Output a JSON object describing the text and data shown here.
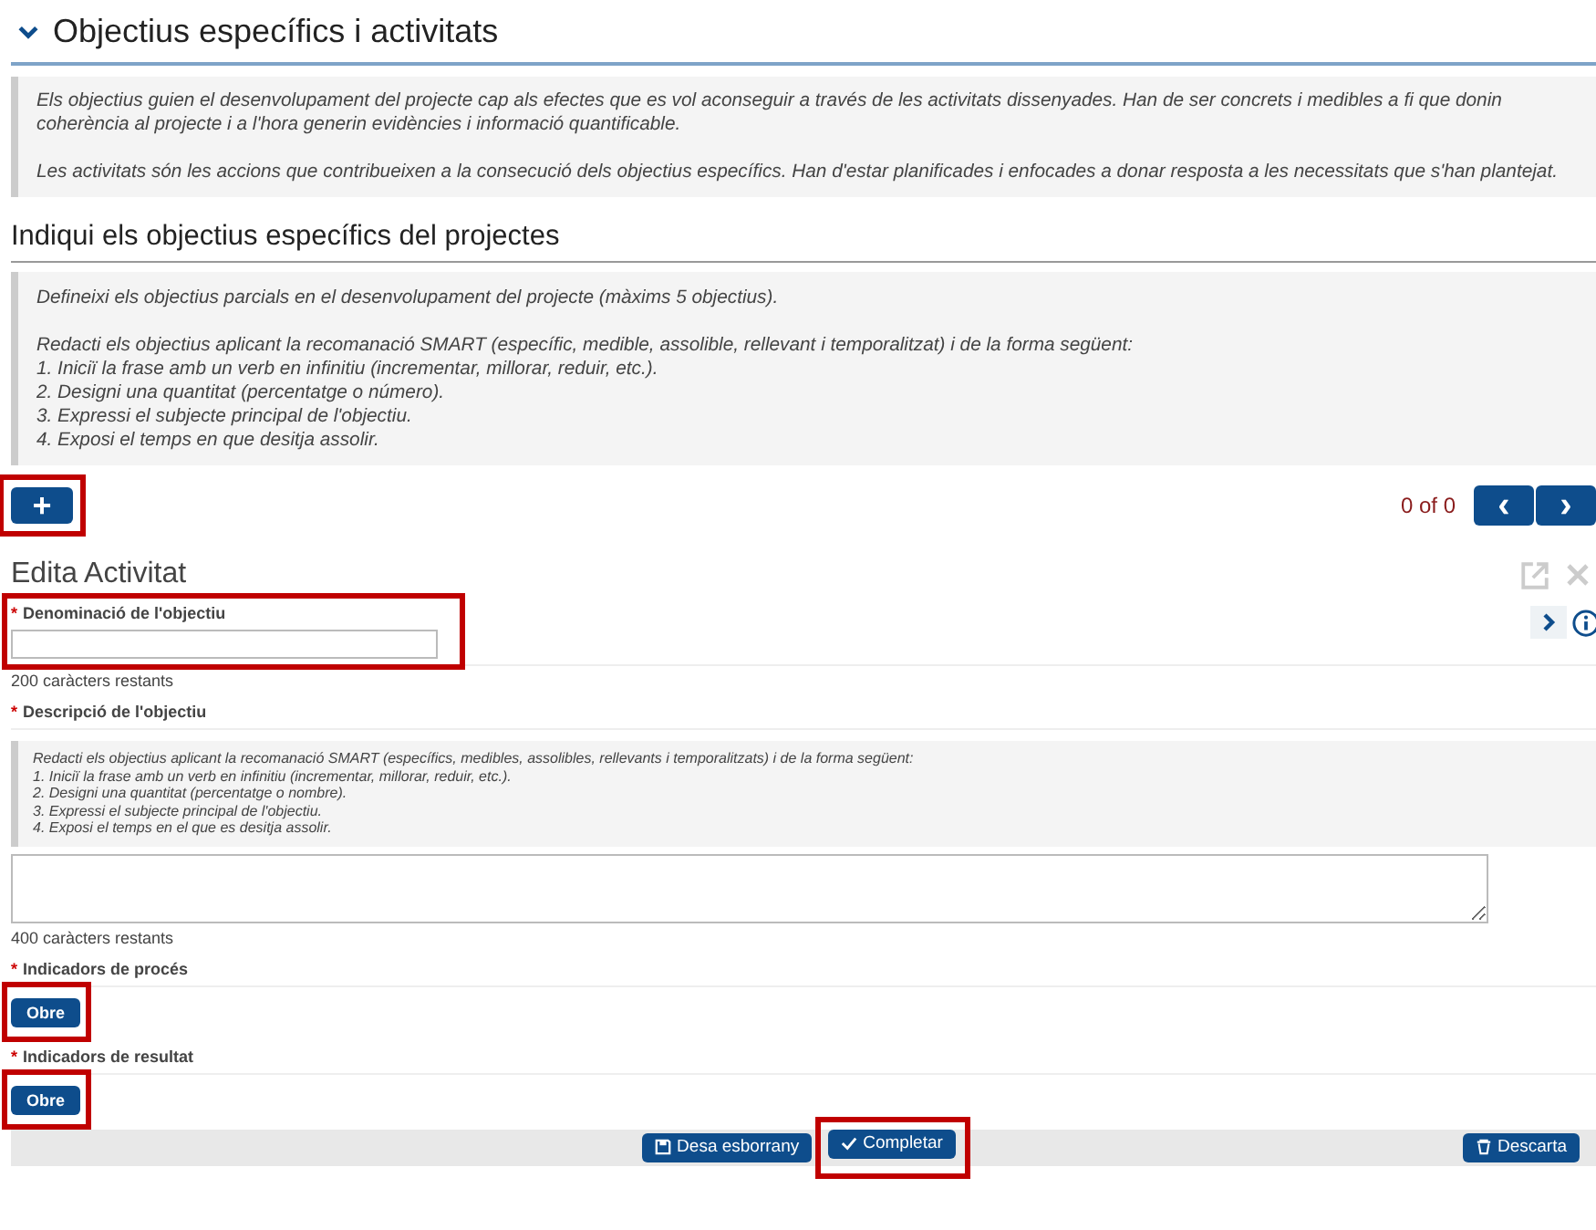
{
  "section": {
    "title": "Objectius específics i activitats",
    "expanded": true,
    "info": [
      "Els objectius guien el desenvolupament del projecte cap als efectes que es vol aconseguir a través de les activitats dissenyades. Han de ser concrets i medibles a fi que donin coherència al projecte i a l'hora generin evidències i informació quantificable.",
      "Les activitats són les accions que contribueixen a la consecució dels objectius específics. Han d'estar planificades i enfocades a donar resposta a les necessitats que s'han plantejat."
    ]
  },
  "subsection": {
    "title": "Indiqui els objectius específics del projectes",
    "info": [
      "Defineixi els objectius parcials en el desenvolupament del projecte (màxims 5 objectius).",
      "Redacti els objectius aplicant la recomanació SMART (específic, medible, assolible, rellevant i temporalitzat) i de la forma següent:\n1. Iniciï la frase amb un verb en infinitiu (incrementar, millorar, reduir, etc.).\n2. Designi una quantitat (percentatge o número).\n3. Expressi el subjecte principal de l'objectiu.\n4. Exposi el temps en que desitja assolir."
    ]
  },
  "add_button": {
    "label": "+",
    "highlighted": true
  },
  "pager": {
    "text": "0 of 0",
    "prev": "‹",
    "next": "›"
  },
  "editor": {
    "title": "Edita Activitat",
    "fields": [
      {
        "kind": "input",
        "required": "*",
        "label": "Denominació de l'objectiu",
        "highlighted": true,
        "hint": "200 caràcters restants"
      },
      {
        "kind": "textarea",
        "required": "*",
        "label": "Descripció de l'objectiu",
        "info": "Redacti els objectius aplicant la recomanació SMART (específics, medibles, assolibles, rellevants i temporalitzats) i de la forma següent:\n1. Iniciï la frase amb un verb en infinitiu (incrementar, millorar, reduir, etc.).\n2. Designi una quantitat (percentatge o nombre).\n3. Expressi el subjecte principal de l'objectiu.\n4. Exposi el temps en el que es desitja assolir.",
        "hint": "400 caràcters restants"
      },
      {
        "kind": "button",
        "required": "*",
        "label": "Indicadors de procés",
        "button": "Obre",
        "highlighted": true
      },
      {
        "kind": "button",
        "required": "*",
        "label": "Indicadors de resultat",
        "button": "Obre",
        "highlighted": true
      }
    ],
    "footer": [
      {
        "label": "Desa esborrany",
        "kind": "save",
        "highlighted": false
      },
      {
        "label": "Completar",
        "kind": "check",
        "highlighted": true
      },
      {
        "label": "Descarta",
        "kind": "trash",
        "highlighted": false
      }
    ]
  }
}
